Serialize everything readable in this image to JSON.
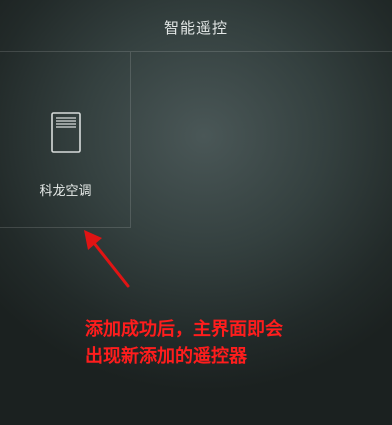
{
  "header": {
    "title": "智能遥控"
  },
  "remotes": [
    {
      "label": "科龙空调",
      "icon": "air-conditioner-icon"
    }
  ],
  "annotation": {
    "color": "#ff1d1d",
    "lines": [
      "添加成功后，主界面即会",
      "出现新添加的遥控器"
    ]
  }
}
